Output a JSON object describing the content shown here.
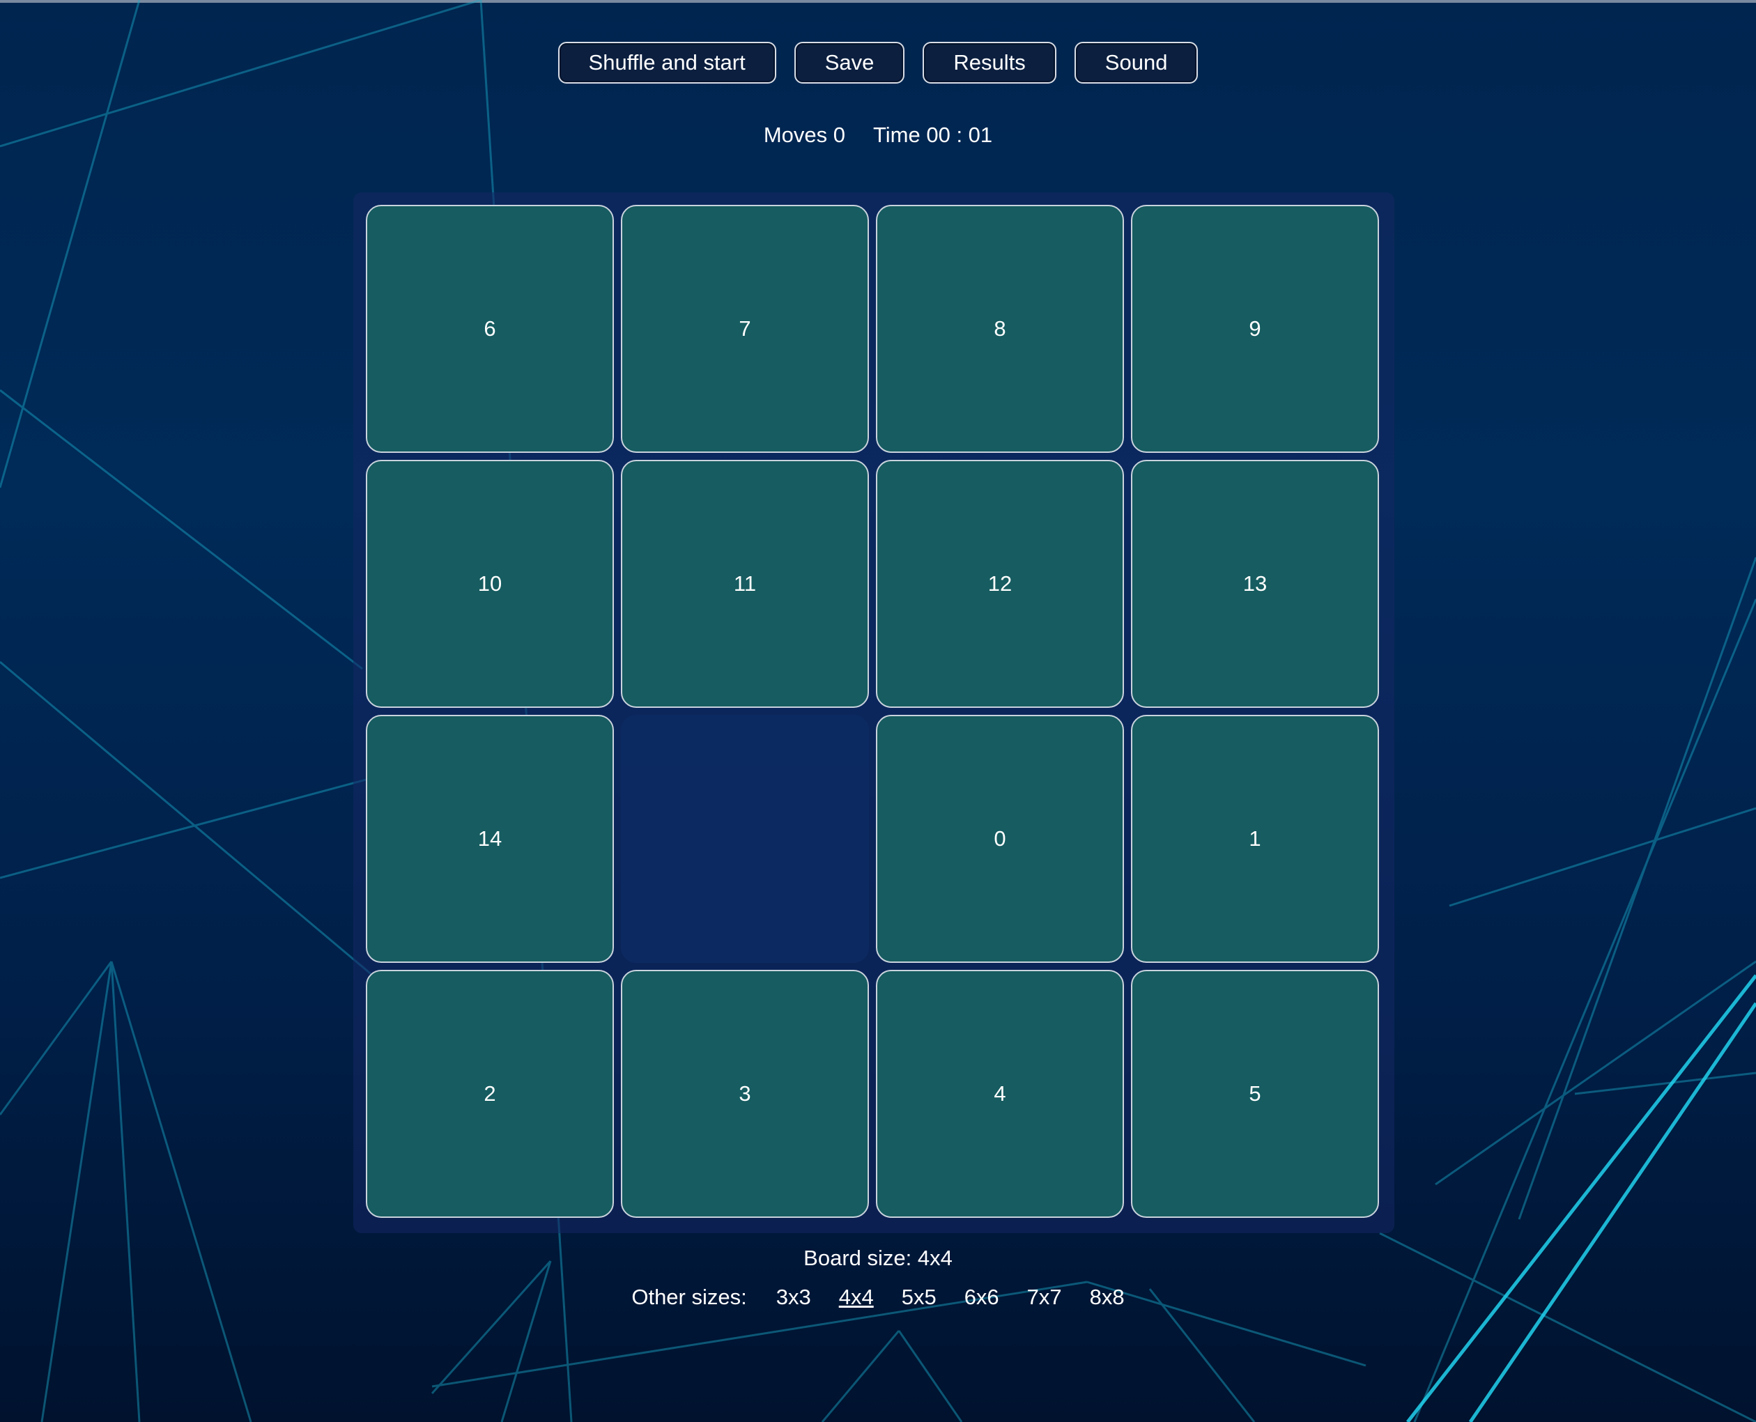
{
  "controls": {
    "shuffle_label": "Shuffle and start",
    "save_label": "Save",
    "results_label": "Results",
    "sound_label": "Sound"
  },
  "stats": {
    "moves": "Moves 0",
    "time": "Time 00 : 01"
  },
  "board": {
    "rows": 4,
    "cols": 4,
    "tiles": [
      "6",
      "7",
      "8",
      "9",
      "10",
      "11",
      "12",
      "13",
      "14",
      "",
      "0",
      "1",
      "2",
      "3",
      "4",
      "5"
    ]
  },
  "footer": {
    "board_size": "Board size: 4x4",
    "other_sizes_label": "Other sizes:",
    "sizes": [
      "3x3",
      "4x4",
      "5x5",
      "6x6",
      "7x7",
      "8x8"
    ],
    "active_size": "4x4"
  },
  "colors": {
    "tile": "#165c60",
    "tile_border": "#c9d3dd",
    "button_bg": "#0c1f3f",
    "accent_lines": "#14b8d6"
  }
}
